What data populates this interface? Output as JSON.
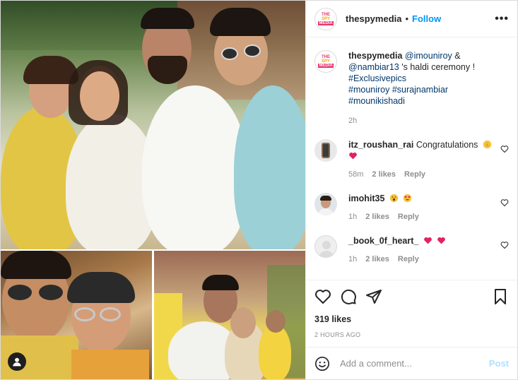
{
  "account": {
    "username": "thespymedia",
    "separator": "•",
    "follow_label": "Follow",
    "more_label": "•••",
    "logo_text": [
      "THE",
      "SPY",
      "MEDIA"
    ]
  },
  "caption": {
    "username": "thespymedia",
    "mention1": "@imouniroy",
    "amp": " & ",
    "mention2": "@nambiar13",
    "text": " 's haldi ceremony !",
    "tag1": "#Exclusivepics",
    "tag2": "#mouniroy",
    "tag3": "#surajnambiar",
    "tag4": "#mounikishadi",
    "time": "2h"
  },
  "comments": [
    {
      "username": "itz_roushan_rai",
      "text": "Congratulations",
      "emojis": [
        "clap-emoji",
        "red-heart-emoji"
      ],
      "age": "58m",
      "likes": "2 likes",
      "reply": "Reply"
    },
    {
      "username": "imohit35",
      "text": "",
      "emojis": [
        "open-mouth-emoji",
        "heart-eyes-emoji"
      ],
      "age": "1h",
      "likes": "2 likes",
      "reply": "Reply"
    },
    {
      "username": "_book_0f_heart_",
      "text": "",
      "emojis": [
        "red-heart-emoji",
        "red-heart-emoji"
      ],
      "age": "1h",
      "likes": "2 likes",
      "reply": "Reply"
    }
  ],
  "actions": {
    "likes": "319 likes",
    "posted": "2 HOURS AGO"
  },
  "composer": {
    "placeholder": "Add a comment...",
    "post_label": "Post"
  },
  "colors": {
    "link": "#00376b",
    "follow": "#0095f6",
    "muted": "#8e8e8e",
    "heart": "#ed4956",
    "post_disabled": "#b2dffc"
  }
}
